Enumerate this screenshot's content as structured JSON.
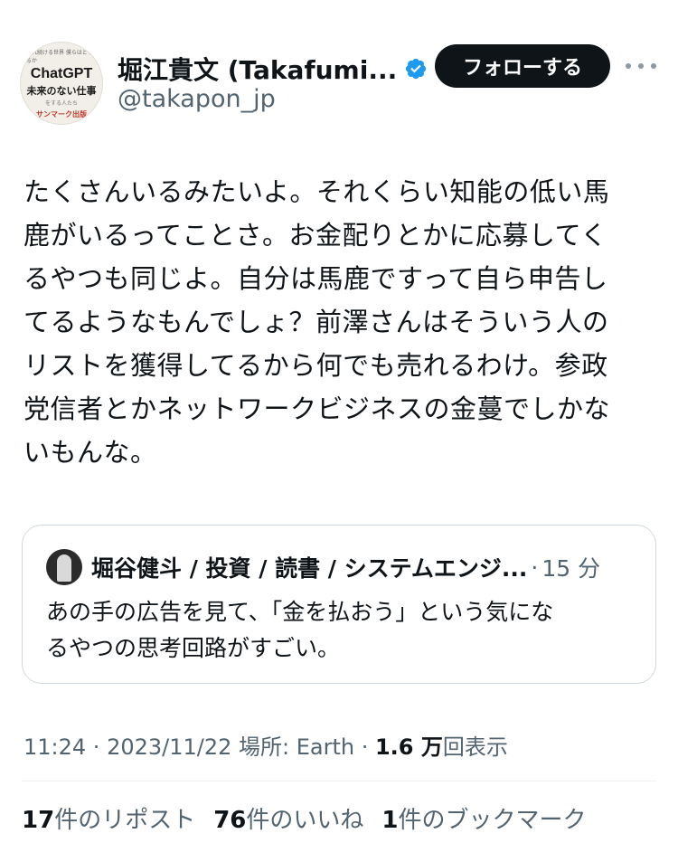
{
  "author": {
    "display_name": "堀江貴文 (Takafumi...",
    "handle": "@takapon_jp",
    "verified_icon": "verified-badge-icon",
    "avatar_text": {
      "line1": "止まれ続ける世界 僕らはどう生きるか",
      "line2": "ChatGPT",
      "line3": "未来のない仕事",
      "line4": "をする人たち",
      "line5": "サンマーク出版"
    }
  },
  "actions": {
    "follow_label": "フォローする",
    "more_icon": "more-options-icon"
  },
  "tweet": {
    "lines": [
      "たくさんいるみたいよ。それくらい知能の低い馬",
      "鹿がいるってことさ。お金配りとかに応募してく",
      "るやつも同じよ。自分は馬鹿ですって自ら申告し",
      "てるようなもんでしょ？前澤さんはそういう人の",
      "リストを獲得してるから何でも売れるわけ。参政",
      "党信者とかネットワークビジネスの金蔓でしかな",
      "いもんな。"
    ]
  },
  "quote": {
    "name": "堀谷健斗 / 投資 / 読書 / システムエンジ...",
    "separator": "·",
    "time": "15 分",
    "lines": [
      "あの手の広告を見て、「金を払おう」という気にな",
      "るやつの思考回路がすごい。"
    ]
  },
  "meta": {
    "time": "11:24",
    "sep1": " · ",
    "date": "2023/11/22",
    "location_label": " 場所: ",
    "location": "Earth",
    "sep2": " · ",
    "views_count": "1.6 万",
    "views_label": "回表示"
  },
  "stats": {
    "reposts_count": "17",
    "reposts_label": "件のリポスト",
    "likes_count": "76",
    "likes_label": "件のいいね",
    "bookmarks_count": "1",
    "bookmarks_label": "件のブックマーク"
  },
  "colors": {
    "accent": "#1d9bf0",
    "text": "#0f1419",
    "muted": "#536471",
    "button_bg": "#0f1419"
  }
}
